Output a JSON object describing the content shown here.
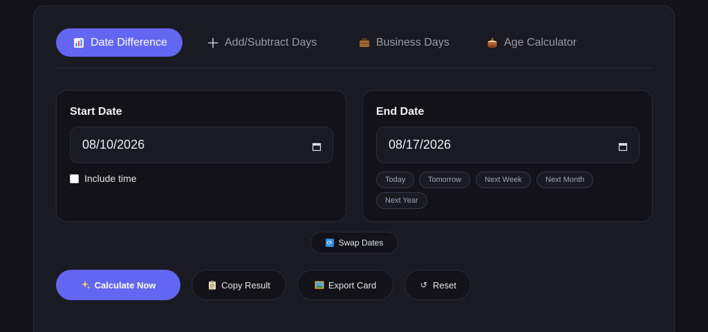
{
  "tabs": [
    {
      "label": "Date Difference",
      "icon": "bar-chart-icon",
      "active": true
    },
    {
      "label": "Add/Subtract Days",
      "icon": "plus-icon",
      "active": false
    },
    {
      "label": "Business Days",
      "icon": "briefcase-icon",
      "active": false
    },
    {
      "label": "Age Calculator",
      "icon": "cake-icon",
      "active": false
    }
  ],
  "start": {
    "title": "Start Date",
    "value": "08/10/2026",
    "include_time_label": "Include time",
    "include_time_checked": false
  },
  "end": {
    "title": "End Date",
    "value": "08/17/2026",
    "shortcuts": [
      "Today",
      "Tomorrow",
      "Next Week",
      "Next Month",
      "Next Year"
    ]
  },
  "swap_label": "Swap Dates",
  "actions": {
    "calculate": "Calculate Now",
    "copy": "Copy Result",
    "export": "Export Card",
    "reset": "Reset"
  },
  "colors": {
    "accent": "#6366f1",
    "background": "#121218",
    "card": "#1a1a22"
  }
}
